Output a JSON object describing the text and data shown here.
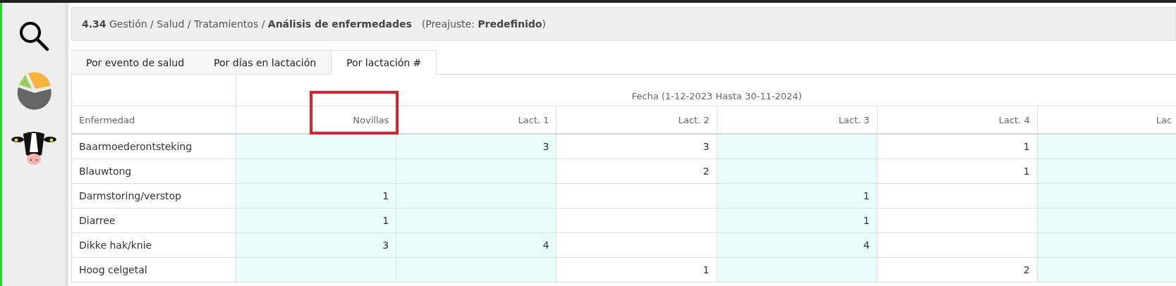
{
  "header": {
    "title": "**4.34** Gestión / Salud / Tratamientos / **Análisis de enfermedades**",
    "preset": "(Preajuste: **Predefinido**)"
  },
  "tabs": [
    {
      "label": "Por evento de salud",
      "selected": false
    },
    {
      "label": "Por días en lactación",
      "selected": false
    },
    {
      "label": "Por lactación #",
      "selected": true
    }
  ],
  "table": {
    "group_header": "Fecha (1-12-2023 Hasta 30-11-2024)",
    "first_column": "Enfermedad",
    "columns": [
      {
        "label": "Novillas",
        "shaded": true,
        "annotated": true
      },
      {
        "label": "Lact. 1",
        "shaded": true,
        "annotated": false
      },
      {
        "label": "Lact. 2",
        "shaded": false,
        "annotated": false
      },
      {
        "label": "Lact. 3",
        "shaded": true,
        "annotated": false
      },
      {
        "label": "Lact. 4",
        "shaded": false,
        "annotated": false
      },
      {
        "label": "Lac",
        "shaded": true,
        "annotated": false
      }
    ],
    "rows": [
      {
        "name": "Baarmoederontsteking",
        "cells": [
          null,
          "3",
          "3",
          null,
          "1",
          null
        ]
      },
      {
        "name": "Blauwtong",
        "cells": [
          null,
          null,
          "2",
          null,
          "1",
          null
        ]
      },
      {
        "name": "Darmstoring/verstop",
        "cells": [
          "1",
          null,
          null,
          "1",
          null,
          null
        ]
      },
      {
        "name": "Diarree",
        "cells": [
          "1",
          null,
          null,
          "1",
          null,
          null
        ]
      },
      {
        "name": "Dikke hak/knie",
        "cells": [
          "3",
          "4",
          null,
          "4",
          null,
          null
        ]
      },
      {
        "name": "Hoog celgetal",
        "cells": [
          null,
          null,
          "1",
          null,
          "2",
          null
        ]
      }
    ]
  }
}
